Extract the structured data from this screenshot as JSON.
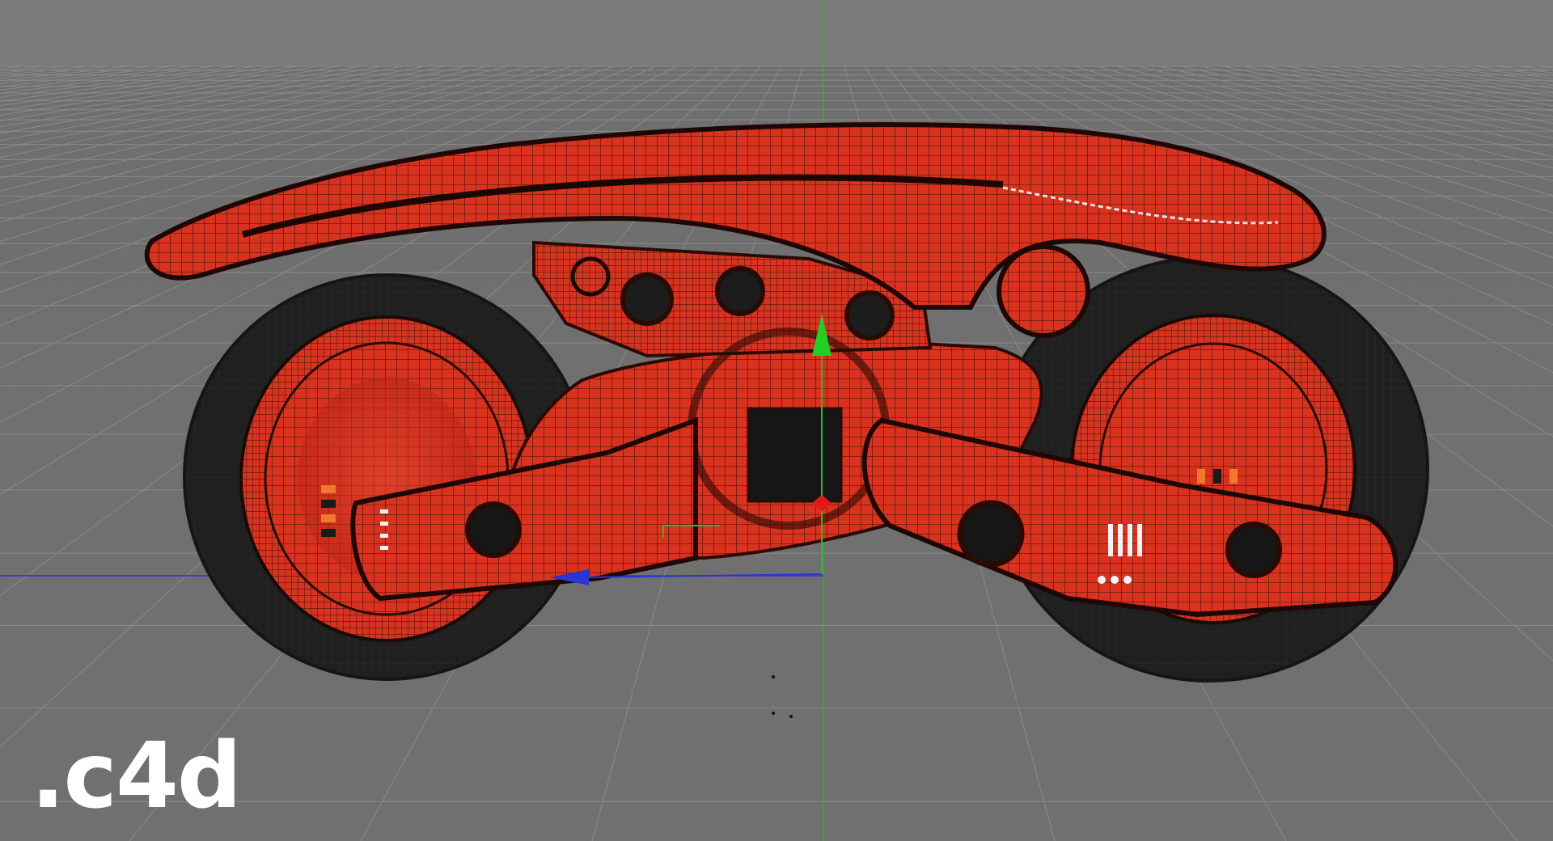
{
  "viewport": {
    "format_label": ".c4d",
    "colors": {
      "background": "#747474",
      "grid_line": "#8a8a8a",
      "model_body": "#d9331f",
      "model_wire": "#2a0a05",
      "tire": "#1e1e1e",
      "axis_y": "#19c619",
      "axis_x": "#2a35d6",
      "axis_z": "#e01818"
    },
    "icons": {
      "move_gizmo": "move-gizmo-icon",
      "y_axis_handle": "y-axis-arrow-icon",
      "x_axis_handle": "x-axis-arrow-icon",
      "z_axis_handle": "z-axis-handle-icon"
    }
  }
}
